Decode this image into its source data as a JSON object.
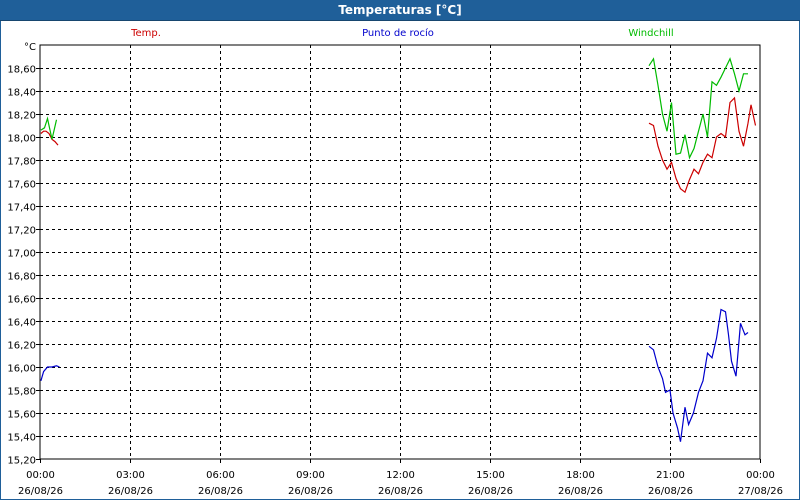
{
  "window": {
    "title": "Temperaturas [°C]"
  },
  "chart_data": {
    "type": "line",
    "title": "Temperaturas [°C]",
    "ylabel": "°C",
    "xlabel": "",
    "ylim": [
      15.2,
      18.8
    ],
    "xlim": [
      0,
      24
    ],
    "grid": true,
    "legend_placement": "top",
    "y_ticks": [
      "15,20",
      "15,40",
      "15,60",
      "15,80",
      "16,00",
      "16,20",
      "16,40",
      "16,60",
      "16,80",
      "17,00",
      "17,20",
      "17,40",
      "17,60",
      "17,80",
      "18,00",
      "18,20",
      "18,40",
      "18,60"
    ],
    "y_tick_values": [
      15.2,
      15.4,
      15.6,
      15.8,
      16.0,
      16.2,
      16.4,
      16.6,
      16.8,
      17.0,
      17.2,
      17.4,
      17.6,
      17.8,
      18.0,
      18.2,
      18.4,
      18.6
    ],
    "x_ticks": [
      {
        "t": 0,
        "time": "00:00",
        "date": "26/08/26"
      },
      {
        "t": 3,
        "time": "03:00",
        "date": "26/08/26"
      },
      {
        "t": 6,
        "time": "06:00",
        "date": "26/08/26"
      },
      {
        "t": 9,
        "time": "09:00",
        "date": "26/08/26"
      },
      {
        "t": 12,
        "time": "12:00",
        "date": "26/08/26"
      },
      {
        "t": 15,
        "time": "15:00",
        "date": "26/08/26"
      },
      {
        "t": 18,
        "time": "18:00",
        "date": "26/08/26"
      },
      {
        "t": 21,
        "time": "21:00",
        "date": "26/08/26"
      },
      {
        "t": 24,
        "time": "00:00",
        "date": "27/08/26"
      }
    ],
    "series": [
      {
        "name": "Temp.",
        "color": "#cc0000",
        "segments": [
          [
            [
              0.03,
              18.03
            ],
            [
              0.12,
              18.05
            ],
            [
              0.2,
              18.05
            ],
            [
              0.3,
              18.03
            ],
            [
              0.4,
              17.98
            ],
            [
              0.5,
              17.96
            ],
            [
              0.6,
              17.93
            ]
          ],
          [
            [
              20.3,
              18.12
            ],
            [
              20.45,
              18.1
            ],
            [
              20.6,
              17.92
            ],
            [
              20.75,
              17.8
            ],
            [
              20.9,
              17.72
            ],
            [
              21.05,
              17.78
            ],
            [
              21.2,
              17.64
            ],
            [
              21.35,
              17.55
            ],
            [
              21.5,
              17.52
            ],
            [
              21.65,
              17.63
            ],
            [
              21.8,
              17.72
            ],
            [
              21.95,
              17.68
            ],
            [
              22.1,
              17.78
            ],
            [
              22.25,
              17.85
            ],
            [
              22.4,
              17.82
            ],
            [
              22.55,
              18.0
            ],
            [
              22.7,
              18.03
            ],
            [
              22.85,
              18.0
            ],
            [
              23.0,
              18.3
            ],
            [
              23.15,
              18.34
            ],
            [
              23.3,
              18.05
            ],
            [
              23.45,
              17.92
            ],
            [
              23.6,
              18.12
            ],
            [
              23.7,
              18.28
            ],
            [
              23.85,
              18.1
            ]
          ]
        ]
      },
      {
        "name": "Punto de rocío",
        "color": "#0000cc",
        "segments": [
          [
            [
              0.03,
              15.88
            ],
            [
              0.12,
              15.96
            ],
            [
              0.25,
              16.0
            ],
            [
              0.4,
              16.0
            ],
            [
              0.55,
              16.01
            ],
            [
              0.65,
              16.0
            ]
          ],
          [
            [
              20.3,
              16.18
            ],
            [
              20.45,
              16.15
            ],
            [
              20.6,
              16.0
            ],
            [
              20.75,
              15.9
            ],
            [
              20.85,
              15.78
            ],
            [
              21.0,
              15.8
            ],
            [
              21.1,
              15.6
            ],
            [
              21.25,
              15.47
            ],
            [
              21.35,
              15.35
            ],
            [
              21.5,
              15.65
            ],
            [
              21.62,
              15.5
            ],
            [
              21.78,
              15.6
            ],
            [
              21.95,
              15.78
            ],
            [
              22.1,
              15.88
            ],
            [
              22.25,
              16.12
            ],
            [
              22.4,
              16.08
            ],
            [
              22.55,
              16.25
            ],
            [
              22.7,
              16.5
            ],
            [
              22.85,
              16.48
            ],
            [
              22.95,
              16.28
            ],
            [
              23.05,
              16.05
            ],
            [
              23.2,
              15.92
            ],
            [
              23.35,
              16.38
            ],
            [
              23.5,
              16.28
            ],
            [
              23.6,
              16.3
            ]
          ]
        ]
      },
      {
        "name": "Windchill",
        "color": "#00bb00",
        "segments": [
          [
            [
              0.03,
              18.06
            ],
            [
              0.15,
              18.08
            ],
            [
              0.25,
              18.16
            ],
            [
              0.4,
              17.98
            ],
            [
              0.55,
              18.15
            ]
          ],
          [
            [
              20.3,
              18.62
            ],
            [
              20.45,
              18.68
            ],
            [
              20.6,
              18.45
            ],
            [
              20.75,
              18.2
            ],
            [
              20.9,
              18.05
            ],
            [
              21.05,
              18.3
            ],
            [
              21.2,
              17.85
            ],
            [
              21.35,
              17.86
            ],
            [
              21.5,
              18.02
            ],
            [
              21.65,
              17.82
            ],
            [
              21.8,
              17.9
            ],
            [
              21.95,
              18.05
            ],
            [
              22.1,
              18.2
            ],
            [
              22.25,
              18.0
            ],
            [
              22.4,
              18.48
            ],
            [
              22.55,
              18.45
            ],
            [
              22.7,
              18.52
            ],
            [
              22.85,
              18.6
            ],
            [
              23.0,
              18.68
            ],
            [
              23.15,
              18.55
            ],
            [
              23.3,
              18.4
            ],
            [
              23.45,
              18.55
            ],
            [
              23.6,
              18.55
            ]
          ]
        ]
      }
    ]
  }
}
